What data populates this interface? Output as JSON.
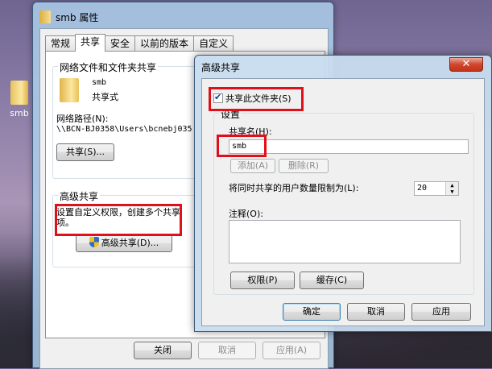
{
  "desktop": {
    "icon_label": "smb"
  },
  "props_window": {
    "title": "smb 属性",
    "tabs": [
      "常规",
      "共享",
      "安全",
      "以前的版本",
      "自定义"
    ],
    "active_tab": 1,
    "net_share_group": "网络文件和文件夹共享",
    "folder_name": "smb",
    "folder_state": "共享式",
    "net_path_label": "网络路径(N):",
    "net_path_value": "\\\\BCN-BJ0358\\Users\\bcnebj035",
    "share_button": "共享(S)...",
    "adv_group": "高级共享",
    "adv_desc_line1": "设置自定义权限，创建多个共享",
    "adv_desc_line2": "项。",
    "adv_button": "高级共享(D)...",
    "close_button": "关闭",
    "cancel_button": "取消",
    "apply_button": "应用(A)"
  },
  "adv_dialog": {
    "title": "高级共享",
    "close_glyph": "✕",
    "share_checkbox": "共享此文件夹(S)",
    "share_checked": true,
    "settings_label": "设置",
    "share_name_label": "共享名(H):",
    "share_name_value": "smb",
    "add_button": "添加(A)",
    "remove_button": "删除(R)",
    "limit_label": "将同时共享的用户数量限制为(L):",
    "limit_value": "20",
    "comment_label": "注释(O):",
    "permissions_button": "权限(P)",
    "cache_button": "缓存(C)",
    "ok_button": "确定",
    "cancel_button": "取消",
    "apply_button": "应用"
  }
}
